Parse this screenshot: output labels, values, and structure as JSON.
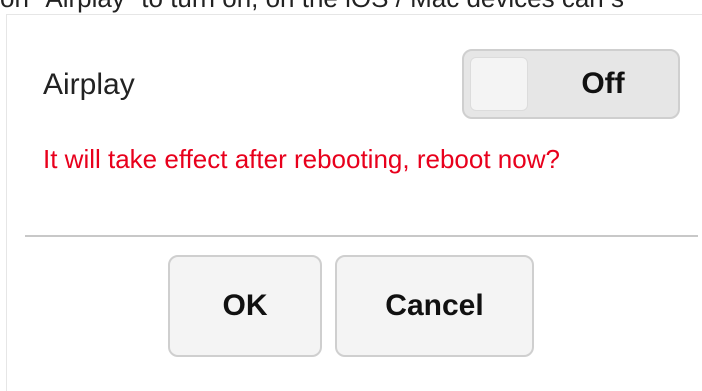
{
  "caption": "on \"Airplay\" to turn on, on the iOS / Mac devices can s",
  "setting": {
    "label": "Airplay",
    "toggle_state": "Off"
  },
  "warning_message": "It will take effect after rebooting, reboot now?",
  "buttons": {
    "ok": "OK",
    "cancel": "Cancel"
  },
  "colors": {
    "warning": "#e8001c",
    "toggle_track": "#e6e6e6",
    "button_bg": "#f4f4f4",
    "divider": "#c8c8c8"
  }
}
